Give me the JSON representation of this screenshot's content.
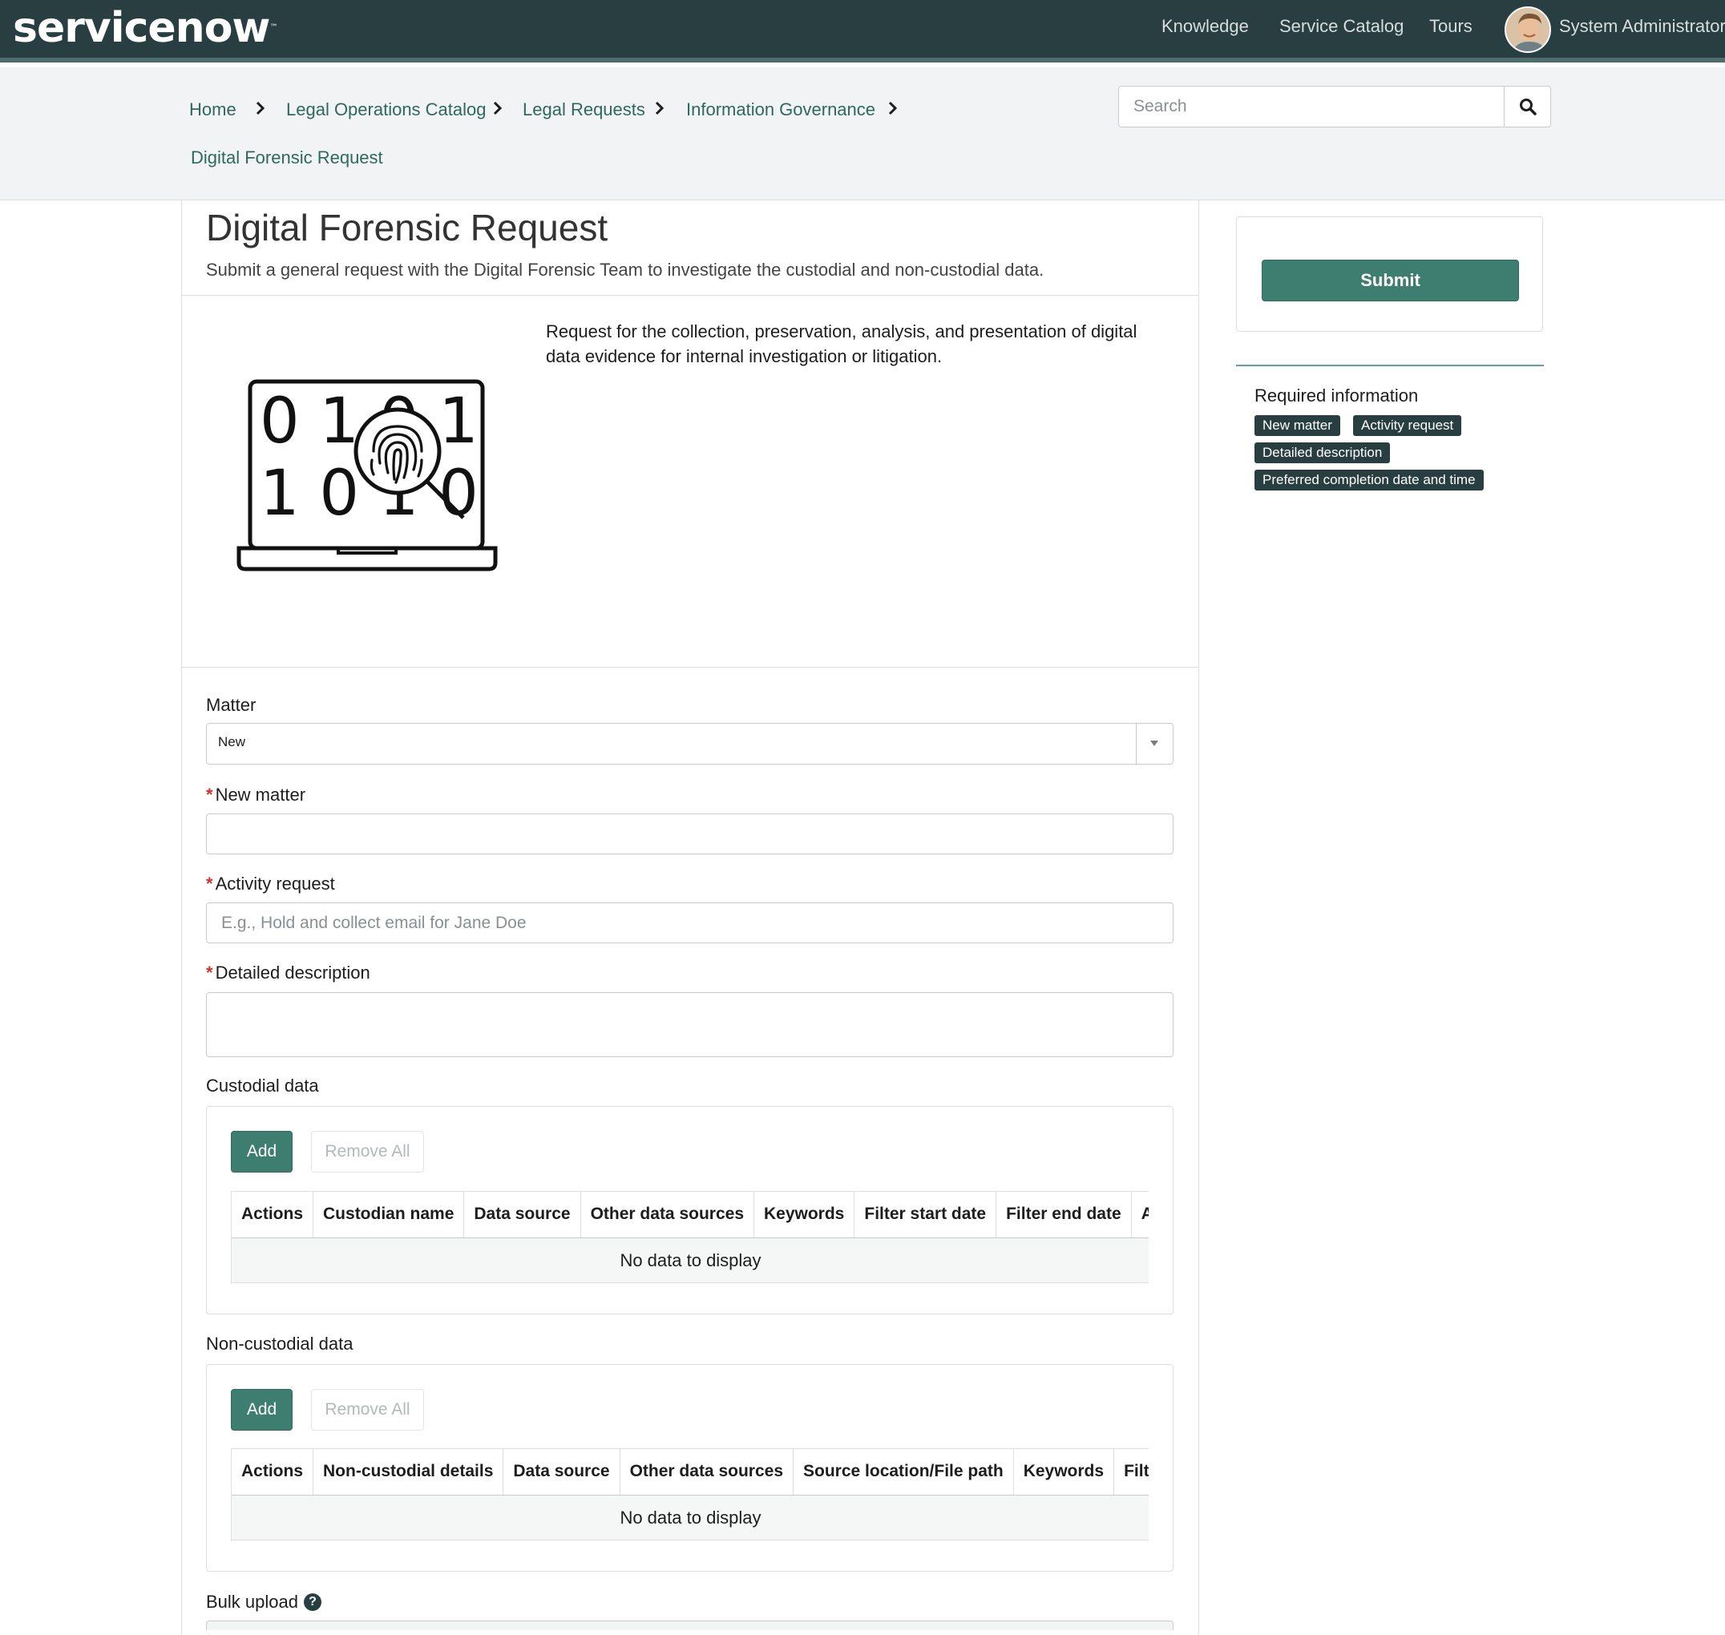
{
  "header": {
    "logo_text": "servicenow",
    "logo_tm": "™",
    "nav": [
      "Knowledge",
      "Service Catalog",
      "Tours"
    ],
    "user_name": "System Administrator",
    "colors": {
      "bar": "#293e40",
      "accent": "#3e7e71"
    }
  },
  "breadcrumb": {
    "items": [
      "Home",
      "Legal Operations Catalog",
      "Legal Requests",
      "Information Governance",
      "Digital Forensic Request"
    ]
  },
  "search": {
    "placeholder": "Search",
    "icon": "search-icon"
  },
  "page": {
    "title": "Digital Forensic Request",
    "subtitle": "Submit a general request with the Digital Forensic Team to investigate the custodial and non-custodial data.",
    "description": "Request for the collection, preservation, analysis, and presentation of digital data evidence for internal investigation or litigation.",
    "illustration": {
      "icon": "laptop-fingerprint-icon",
      "row1": "0 1 0 1",
      "row2": "1 0 1 0 1"
    }
  },
  "form": {
    "matter": {
      "label": "Matter",
      "value": "New"
    },
    "new_matter": {
      "label": "New matter",
      "value": ""
    },
    "activity_request": {
      "label": "Activity request",
      "placeholder": "E.g., Hold and collect email for Jane Doe"
    },
    "detailed_description": {
      "label": "Detailed description",
      "value": ""
    },
    "custodial": {
      "label": "Custodial data",
      "add_label": "Add",
      "remove_label": "Remove All",
      "columns": [
        "Actions",
        "Custodian name",
        "Data source",
        "Other data sources",
        "Keywords",
        "Filter start date",
        "Filter end date",
        "Add"
      ],
      "empty_text": "No data to display"
    },
    "non_custodial": {
      "label": "Non-custodial data",
      "add_label": "Add",
      "remove_label": "Remove All",
      "columns": [
        "Actions",
        "Non-custodial details",
        "Data source",
        "Other data sources",
        "Source location/File path",
        "Keywords",
        "Filter s"
      ],
      "empty_text": "No data to display"
    },
    "bulk_upload": {
      "label": "Bulk upload",
      "help_glyph": "?"
    }
  },
  "sidebar": {
    "submit_label": "Submit",
    "required_title": "Required information",
    "required_tags": [
      "New matter",
      "Activity request",
      "Detailed description",
      "Preferred completion date and time"
    ]
  }
}
